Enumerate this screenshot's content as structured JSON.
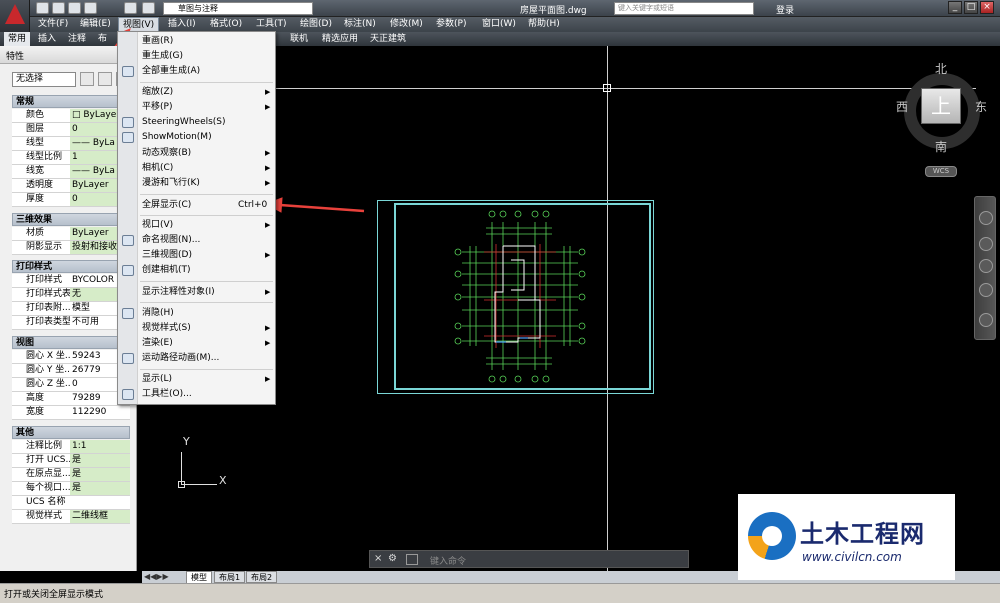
{
  "title_bar": {
    "workspace": "草图与注释",
    "filename": "房屋平面图.dwg",
    "search_placeholder": "键入关键字或短语",
    "login": "登录"
  },
  "menubar": [
    {
      "label": "文件(F)"
    },
    {
      "label": "编辑(E)"
    },
    {
      "label": "视图(V)"
    },
    {
      "label": "插入(I)"
    },
    {
      "label": "格式(O)"
    },
    {
      "label": "工具(T)"
    },
    {
      "label": "绘图(D)"
    },
    {
      "label": "标注(N)"
    },
    {
      "label": "修改(M)"
    },
    {
      "label": "参数(P)"
    },
    {
      "label": "窗口(W)"
    },
    {
      "label": "帮助(H)"
    }
  ],
  "ribbon_tabs": [
    "常用",
    "插入",
    "注释",
    "布",
    "联机",
    "精选应用",
    "天正建筑"
  ],
  "properties": {
    "caption": "特性",
    "selection": "无选择",
    "sections": {
      "general": "常规",
      "3d": "三维效果",
      "plot": "打印样式",
      "view": "视图",
      "misc": "其他"
    },
    "general_rows": [
      {
        "k": "颜色",
        "v": "□ ByLayer"
      },
      {
        "k": "图层",
        "v": "0"
      },
      {
        "k": "线型",
        "v": "—— ByLa"
      },
      {
        "k": "线型比例",
        "v": "1"
      },
      {
        "k": "线宽",
        "v": "—— ByLa"
      },
      {
        "k": "透明度",
        "v": "ByLayer"
      },
      {
        "k": "厚度",
        "v": "0"
      }
    ],
    "effect_rows": [
      {
        "k": "材质",
        "v": "ByLayer"
      },
      {
        "k": "阴影显示",
        "v": "投射和接收"
      }
    ],
    "plot_rows": [
      {
        "k": "打印样式",
        "v": "BYCOLOR"
      },
      {
        "k": "打印样式表",
        "v": "无"
      },
      {
        "k": "打印表附...",
        "v": "模型"
      },
      {
        "k": "打印表类型",
        "v": "不可用"
      }
    ],
    "view_rows": [
      {
        "k": "圆心 X 坐...",
        "v": "59243"
      },
      {
        "k": "圆心 Y 坐...",
        "v": "26779"
      },
      {
        "k": "圆心 Z 坐...",
        "v": "0"
      },
      {
        "k": "高度",
        "v": "79289"
      },
      {
        "k": "宽度",
        "v": "112290"
      }
    ],
    "misc_rows": [
      {
        "k": "注释比例",
        "v": "1:1"
      },
      {
        "k": "打开 UCS...",
        "v": "是"
      },
      {
        "k": "在原点显...",
        "v": "是"
      },
      {
        "k": "每个视口...",
        "v": "是"
      },
      {
        "k": "UCS 名称",
        "v": ""
      },
      {
        "k": "视觉样式",
        "v": "二维线框"
      }
    ]
  },
  "view_menu": {
    "items": [
      {
        "label": "重画(R)"
      },
      {
        "label": "重生成(G)"
      },
      {
        "label": "全部重生成(A)"
      },
      {
        "label": "缩放(Z)"
      },
      {
        "label": "平移(P)"
      },
      {
        "label": "SteeringWheels(S)"
      },
      {
        "label": "ShowMotion(M)"
      },
      {
        "label": "动态观察(B)"
      },
      {
        "label": "相机(C)"
      },
      {
        "label": "漫游和飞行(K)"
      },
      {
        "label": "全屏显示(C)",
        "shortcut": "Ctrl+0"
      },
      {
        "label": "视口(V)"
      },
      {
        "label": "命名视图(N)..."
      },
      {
        "label": "三维视图(D)"
      },
      {
        "label": "创建相机(T)"
      },
      {
        "label": "显示注释性对象(I)"
      },
      {
        "label": "消隐(H)"
      },
      {
        "label": "视觉样式(S)"
      },
      {
        "label": "渲染(E)"
      },
      {
        "label": "运动路径动画(M)..."
      },
      {
        "label": "显示(L)"
      },
      {
        "label": "工具栏(O)..."
      }
    ]
  },
  "viewcube": {
    "north": "北",
    "south": "南",
    "east": "东",
    "west": "西",
    "face": "上",
    "ucs": "WCS"
  },
  "ucs_icon": {
    "x": "X",
    "y": "Y"
  },
  "command_line": {
    "placeholder": "键入命令"
  },
  "layout_tabs": [
    "模型",
    "布局1",
    "布局2"
  ],
  "status_bar": {
    "text": "打开或关闭全屏显示模式"
  },
  "watermark": {
    "title": "土木工程网",
    "url": "www.civilcn.com"
  },
  "colors": {
    "accent_red": "#e8413b",
    "drawing_cyan": "#7ad6d6",
    "drawing_green": "#58d358"
  }
}
